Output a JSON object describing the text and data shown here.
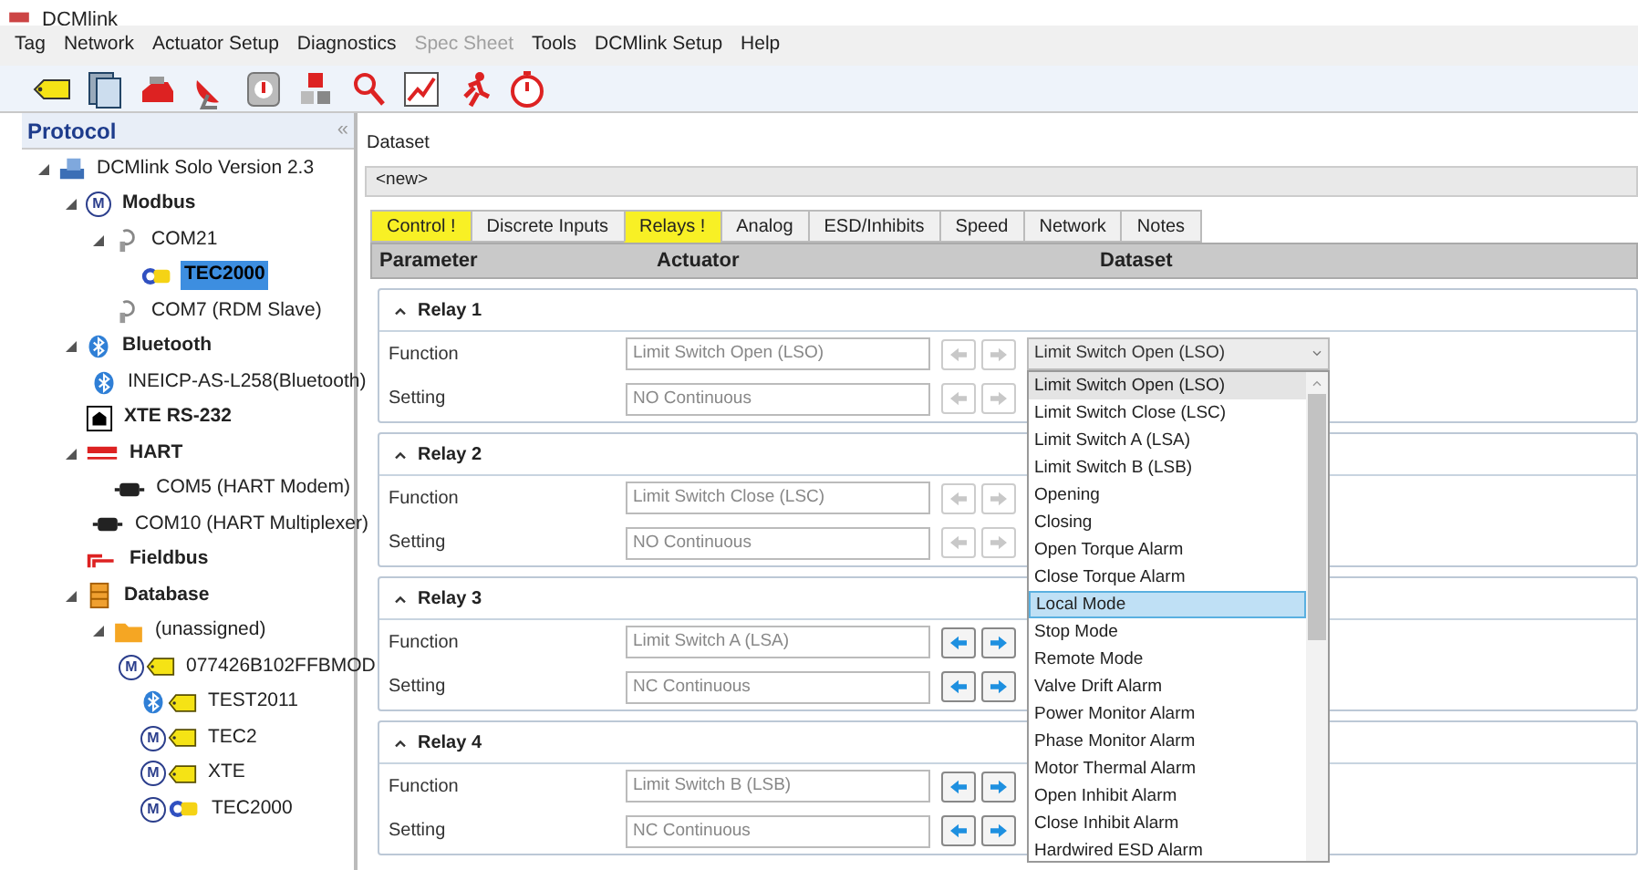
{
  "window": {
    "title": "DCMlink"
  },
  "menu": [
    {
      "label": "Tag",
      "disabled": false
    },
    {
      "label": "Network",
      "disabled": false
    },
    {
      "label": "Actuator Setup",
      "disabled": false
    },
    {
      "label": "Diagnostics",
      "disabled": false
    },
    {
      "label": "Spec Sheet",
      "disabled": true
    },
    {
      "label": "Tools",
      "disabled": false
    },
    {
      "label": "DCMlink Setup",
      "disabled": false
    },
    {
      "label": "Help",
      "disabled": false
    }
  ],
  "sidebar": {
    "title": "Protocol",
    "collapse": "«",
    "tree": [
      {
        "label": "DCMlink Solo Version 2.3",
        "kind": "computer",
        "expanded": true,
        "selected": false,
        "children": [
          {
            "label": "Modbus",
            "kind": "modbus",
            "icon_text": "M",
            "expanded": true,
            "selected": false,
            "children": [
              {
                "label": "COM21",
                "kind": "port",
                "expanded": true,
                "selected": false,
                "children": [
                  {
                    "label": "TEC2000",
                    "kind": "device",
                    "selected": true
                  }
                ]
              },
              {
                "label": "COM7 (RDM Slave)",
                "kind": "port",
                "selected": false
              }
            ]
          },
          {
            "label": "Bluetooth",
            "kind": "bluetooth",
            "expanded": true,
            "selected": false,
            "children": [
              {
                "label": "INEICP-AS-L258(Bluetooth)",
                "kind": "bluetooth",
                "selected": false
              }
            ]
          },
          {
            "label": "XTE RS-232",
            "kind": "serial",
            "selected": false
          },
          {
            "label": "HART",
            "kind": "hart",
            "expanded": true,
            "selected": false,
            "children": [
              {
                "label": "COM5 (HART Modem)",
                "kind": "modem",
                "selected": false
              },
              {
                "label": "COM10 (HART Multiplexer)",
                "kind": "modem",
                "selected": false
              }
            ]
          },
          {
            "label": "Fieldbus",
            "kind": "fieldbus",
            "selected": false
          },
          {
            "label": "Database",
            "kind": "database",
            "expanded": true,
            "selected": false,
            "children": [
              {
                "label": "(unassigned)",
                "kind": "folder",
                "expanded": true,
                "selected": false,
                "children": [
                  {
                    "label": "077426B102FFBMOD",
                    "kind": "modbus-tag",
                    "icon_text": "M",
                    "selected": false
                  },
                  {
                    "label": "TEST2011",
                    "kind": "bluetooth-tag",
                    "selected": false
                  },
                  {
                    "label": "TEC2",
                    "kind": "modbus-tag",
                    "icon_text": "M",
                    "selected": false
                  },
                  {
                    "label": "XTE",
                    "kind": "modbus-tag",
                    "icon_text": "M",
                    "selected": false
                  },
                  {
                    "label": "TEC2000",
                    "kind": "modbus-device",
                    "icon_text": "M",
                    "selected": false
                  }
                ]
              }
            ]
          }
        ]
      }
    ]
  },
  "dataset": {
    "label": "Dataset",
    "value": "<new>"
  },
  "tabs": [
    {
      "label": "Control !",
      "flagged": true,
      "selected": false
    },
    {
      "label": "Discrete Inputs",
      "flagged": false,
      "selected": false
    },
    {
      "label": "Relays !",
      "flagged": true,
      "selected": true
    },
    {
      "label": "Analog",
      "flagged": false,
      "selected": false
    },
    {
      "label": "ESD/Inhibits",
      "flagged": false,
      "selected": false
    },
    {
      "label": "Speed",
      "flagged": false,
      "selected": false
    },
    {
      "label": "Network",
      "flagged": false,
      "selected": false
    },
    {
      "label": "Notes",
      "flagged": false,
      "selected": false
    }
  ],
  "table": {
    "columns": [
      "Parameter",
      "Actuator",
      "Dataset"
    ]
  },
  "relays": [
    {
      "title": "Relay 1",
      "expanded": true,
      "rows": [
        {
          "label": "Function",
          "actuator": "Limit Switch Open (LSO)",
          "arrows_enabled": false,
          "dataset": {
            "value": "Limit Switch Open (LSO)",
            "open": true,
            "options": [
              {
                "label": "Limit Switch Open (LSO)",
                "selected": true
              },
              {
                "label": "Limit Switch Close (LSC)",
                "selected": false
              },
              {
                "label": "Limit Switch A (LSA)",
                "selected": false
              },
              {
                "label": "Limit Switch B (LSB)",
                "selected": false
              },
              {
                "label": "Opening",
                "selected": false
              },
              {
                "label": "Closing",
                "selected": false
              },
              {
                "label": "Open Torque Alarm",
                "selected": false
              },
              {
                "label": "Close Torque Alarm",
                "selected": false
              },
              {
                "label": "Local Mode",
                "selected": false,
                "highlighted": true
              },
              {
                "label": "Stop Mode",
                "selected": false
              },
              {
                "label": "Remote Mode",
                "selected": false
              },
              {
                "label": "Valve Drift Alarm",
                "selected": false
              },
              {
                "label": "Power Monitor Alarm",
                "selected": false
              },
              {
                "label": "Phase Monitor Alarm",
                "selected": false
              },
              {
                "label": "Motor Thermal Alarm",
                "selected": false
              },
              {
                "label": "Open Inhibit Alarm",
                "selected": false
              },
              {
                "label": "Close Inhibit Alarm",
                "selected": false
              },
              {
                "label": "Hardwired ESD Alarm",
                "selected": false
              }
            ]
          }
        },
        {
          "label": "Setting",
          "actuator": "NO Continuous",
          "arrows_enabled": false
        }
      ]
    },
    {
      "title": "Relay 2",
      "expanded": true,
      "rows": [
        {
          "label": "Function",
          "actuator": "Limit Switch Close (LSC)",
          "arrows_enabled": false
        },
        {
          "label": "Setting",
          "actuator": "NO Continuous",
          "arrows_enabled": false
        }
      ]
    },
    {
      "title": "Relay 3",
      "expanded": true,
      "rows": [
        {
          "label": "Function",
          "actuator": "Limit Switch A (LSA)",
          "arrows_enabled": true
        },
        {
          "label": "Setting",
          "actuator": "NC Continuous",
          "arrows_enabled": true
        }
      ]
    },
    {
      "title": "Relay 4",
      "expanded": true,
      "rows": [
        {
          "label": "Function",
          "actuator": "Limit Switch B (LSB)",
          "arrows_enabled": true
        },
        {
          "label": "Setting",
          "actuator": "NC Continuous",
          "arrows_enabled": true
        }
      ]
    }
  ]
}
